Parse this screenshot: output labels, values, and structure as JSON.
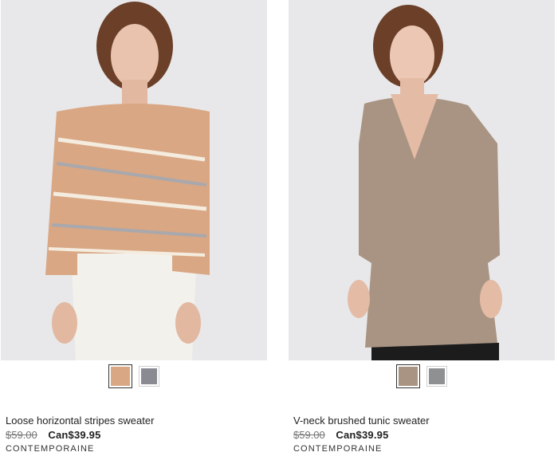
{
  "products": [
    {
      "name": "Loose horizontal stripes sweater",
      "old_price": "$59.00",
      "sale_price": "Can$39.95",
      "brand": "CONTEMPORAINE",
      "swatches": [
        {
          "color": "#d9a784",
          "selected": true
        },
        {
          "color": "#8a8a93",
          "selected": false
        }
      ]
    },
    {
      "name": "V-neck brushed tunic sweater",
      "old_price": "$59.00",
      "sale_price": "Can$39.95",
      "brand": "CONTEMPORAINE",
      "swatches": [
        {
          "color": "#a99483",
          "selected": true
        },
        {
          "color": "#8f9092",
          "selected": false
        }
      ]
    }
  ]
}
